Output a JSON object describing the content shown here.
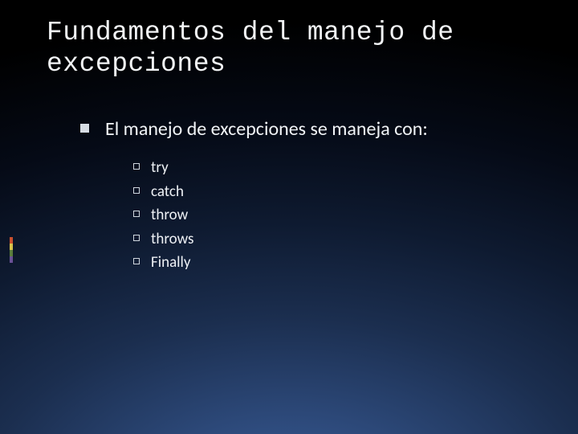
{
  "title": "Fundamentos del manejo de excepciones",
  "main_point": "El manejo de excepciones se maneja con:",
  "sub_points": [
    "try",
    "catch",
    "throw",
    "throws",
    "Finally"
  ],
  "accent_colors": [
    "#c94f2e",
    "#d6c24a",
    "#5a7d3c",
    "#6a5096"
  ]
}
